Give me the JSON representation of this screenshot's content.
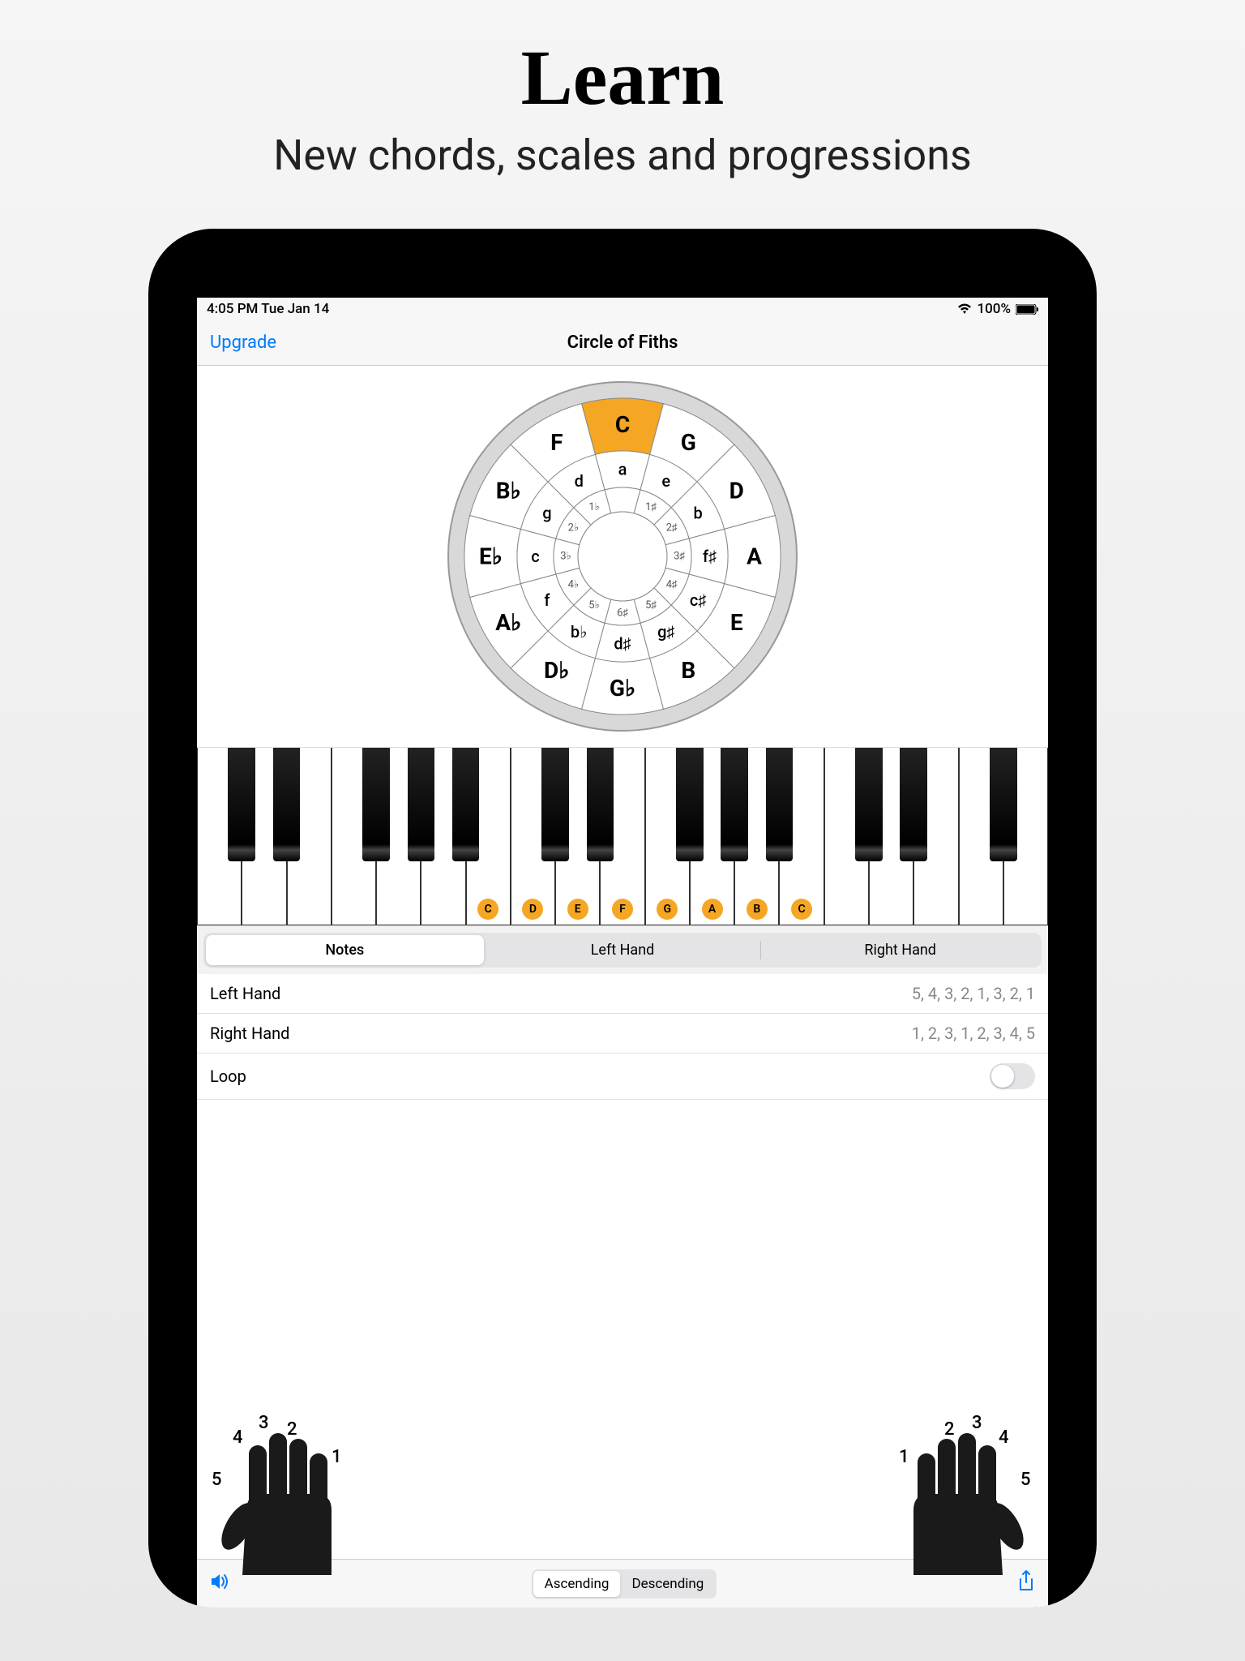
{
  "hero": {
    "title": "Learn",
    "subtitle": "New chords, scales and progressions"
  },
  "status": {
    "time_date": "4:05 PM   Tue Jan 14",
    "battery": "100%"
  },
  "nav": {
    "left": "Upgrade",
    "title": "Circle of Fiths"
  },
  "circle_of_fifths": {
    "selected": "C",
    "outer": [
      "C",
      "G",
      "D",
      "A",
      "E",
      "B",
      "G♭",
      "D♭",
      "A♭",
      "E♭",
      "B♭",
      "F"
    ],
    "middle": [
      "a",
      "e",
      "b",
      "f♯",
      "c♯",
      "g♯",
      "d♯",
      "b♭",
      "f",
      "c",
      "g",
      "d"
    ],
    "inner": [
      "",
      "1♯",
      "2♯",
      "3♯",
      "4♯",
      "5♯",
      "6♯",
      "5♭",
      "4♭",
      "3♭",
      "2♭",
      "1♭"
    ]
  },
  "piano_highlighted": [
    "C",
    "D",
    "E",
    "F",
    "G",
    "A",
    "B",
    "C"
  ],
  "tabs": {
    "items": [
      "Notes",
      "Left Hand",
      "Right Hand"
    ],
    "active": 0
  },
  "rows": {
    "left_hand": {
      "label": "Left Hand",
      "value": "5, 4, 3, 2, 1, 3, 2, 1"
    },
    "right_hand": {
      "label": "Right Hand",
      "value": "1, 2, 3, 1, 2, 3, 4, 5"
    },
    "loop": {
      "label": "Loop",
      "on": false
    }
  },
  "hands": {
    "left_fingers": [
      "5",
      "4",
      "3",
      "2",
      "1"
    ],
    "right_fingers": [
      "1",
      "2",
      "3",
      "4",
      "5"
    ]
  },
  "bottom": {
    "seg": [
      "Ascending",
      "Descending"
    ],
    "active": 0
  }
}
